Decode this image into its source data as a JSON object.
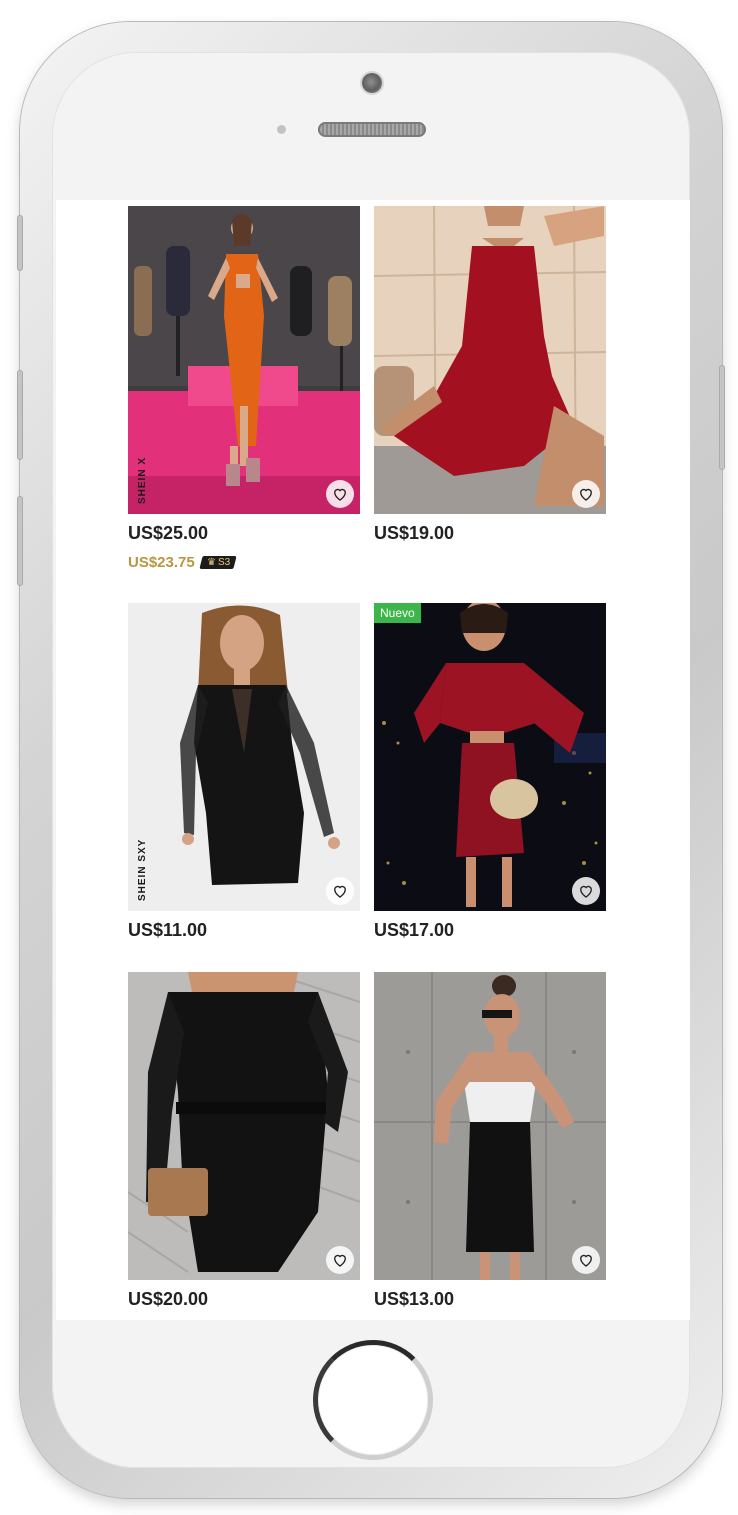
{
  "products": [
    {
      "price": "US$25.00",
      "member_price": "US$23.75",
      "club_level": "S3",
      "brand_mark": "SHEIN X",
      "favorite_icon": "heart-outline-icon",
      "photo": "woman in orange halter cutout ruched dress in studio with mannequins"
    },
    {
      "price": "US$19.00",
      "favorite_icon": "heart-outline-icon",
      "photo": "woman in red halter flowy dress seated on balcony"
    },
    {
      "price": "US$11.00",
      "brand_mark": "SHEIN SXY",
      "favorite_icon": "heart-outline-icon",
      "photo": "woman in black long sleeve mesh bodycon dress on white background"
    },
    {
      "price": "US$17.00",
      "badge": "Nuevo",
      "favorite_icon": "heart-outline-icon",
      "photo": "woman in red glitter cutout dress with city lights at night"
    },
    {
      "price": "US$20.00",
      "favorite_icon": "heart-outline-icon",
      "photo": "woman in black wrap dress with lace sleeves holding clutch"
    },
    {
      "price": "US$13.00",
      "favorite_icon": "heart-outline-icon",
      "photo": "woman in black and white lace cami bodycon dress against concrete wall"
    }
  ],
  "colors": {
    "member_price": "#b8973f",
    "new_badge": "#3cb54a",
    "price_text": "#222222"
  }
}
